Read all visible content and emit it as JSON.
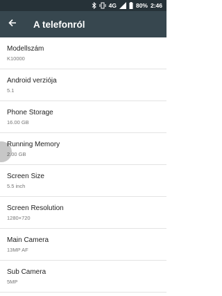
{
  "status_bar": {
    "network": "4G",
    "battery_percent": "80%",
    "time": "2:46",
    "icons": [
      "bluetooth-icon",
      "vibrate-icon",
      "signal-icon",
      "battery-icon"
    ]
  },
  "app_bar": {
    "title": "A telefonról",
    "back_icon": "arrow-back-icon",
    "color": "#37474f"
  },
  "items": [
    {
      "title": "Modellszám",
      "value": "K10000"
    },
    {
      "title": "Android verziója",
      "value": "5.1"
    },
    {
      "title": "Phone Storage",
      "value": "16.00 GB"
    },
    {
      "title": "Running Memory",
      "value": "2.00 GB"
    },
    {
      "title": "Screen Size",
      "value": "5.5 inch"
    },
    {
      "title": "Screen Resolution",
      "value": "1280×720"
    },
    {
      "title": "Main Camera",
      "value": "13MP AF"
    },
    {
      "title": "Sub Camera",
      "value": "5MP"
    }
  ]
}
